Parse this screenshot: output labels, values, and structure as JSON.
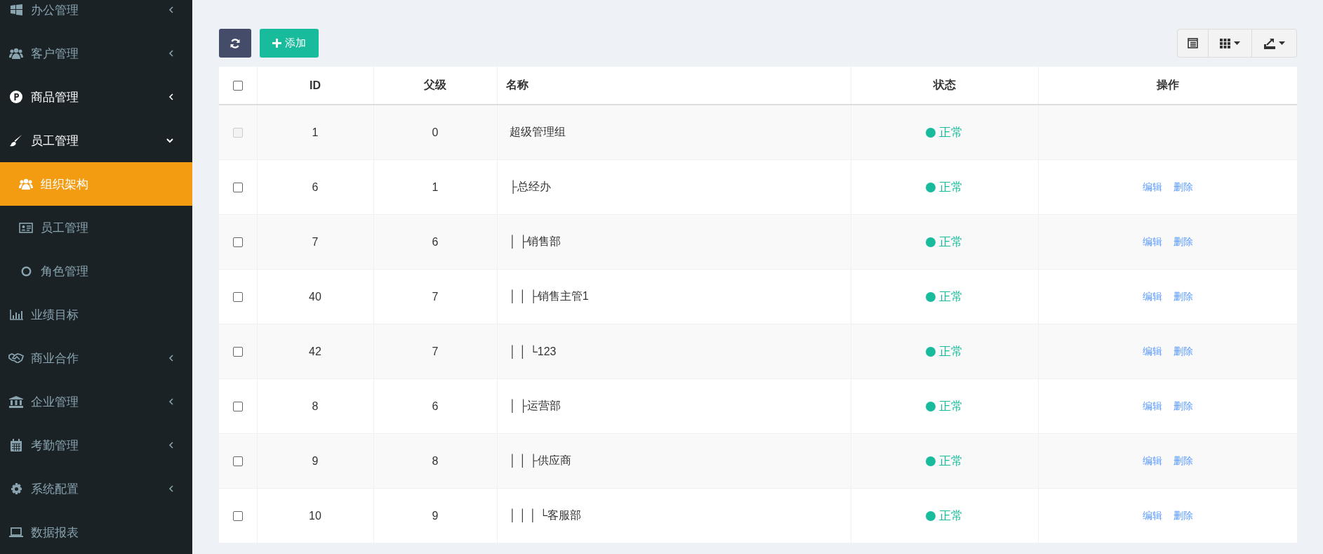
{
  "sidebar": {
    "items": [
      {
        "label": "办公管理",
        "kind": "folder",
        "expanded": false,
        "highlighted": false
      },
      {
        "label": "客户管理",
        "kind": "folder",
        "expanded": false,
        "highlighted": false
      },
      {
        "label": "商品管理",
        "kind": "folder",
        "expanded": false,
        "highlighted": true
      },
      {
        "label": "员工管理",
        "kind": "folder",
        "expanded": true,
        "highlighted": true,
        "children": [
          {
            "label": "组织架构",
            "selected": true
          },
          {
            "label": "员工管理",
            "selected": false
          },
          {
            "label": "角色管理",
            "selected": false
          }
        ]
      },
      {
        "label": "业绩目标",
        "kind": "link",
        "highlighted": false
      },
      {
        "label": "商业合作",
        "kind": "folder",
        "expanded": false,
        "highlighted": false
      },
      {
        "label": "企业管理",
        "kind": "folder",
        "expanded": false,
        "highlighted": false
      },
      {
        "label": "考勤管理",
        "kind": "folder",
        "expanded": false,
        "highlighted": false
      },
      {
        "label": "系统配置",
        "kind": "folder",
        "expanded": false,
        "highlighted": false
      },
      {
        "label": "数据报表",
        "kind": "link",
        "highlighted": false
      }
    ]
  },
  "toolbar": {
    "add_button": "添加"
  },
  "table": {
    "select_all": {
      "checked": false
    },
    "columns": [
      "ID",
      "父级",
      "名称",
      "状态",
      "操作"
    ],
    "rows": [
      {
        "checked": false,
        "disabled": true,
        "id": "1",
        "parent": "0",
        "name": "超级管理组",
        "status": "正常",
        "actions": []
      },
      {
        "checked": false,
        "disabled": false,
        "id": "6",
        "parent": "1",
        "name": "├总经办",
        "status": "正常",
        "actions": [
          "编辑",
          "删除"
        ]
      },
      {
        "checked": false,
        "disabled": false,
        "id": "7",
        "parent": "6",
        "name": "│ ├销售部",
        "status": "正常",
        "actions": [
          "编辑",
          "删除"
        ]
      },
      {
        "checked": false,
        "disabled": false,
        "id": "40",
        "parent": "7",
        "name": "│ │ ├销售主管1",
        "status": "正常",
        "actions": [
          "编辑",
          "删除"
        ]
      },
      {
        "checked": false,
        "disabled": false,
        "id": "42",
        "parent": "7",
        "name": "│ │ └123",
        "status": "正常",
        "actions": [
          "编辑",
          "删除"
        ]
      },
      {
        "checked": false,
        "disabled": false,
        "id": "8",
        "parent": "6",
        "name": "│ ├运营部",
        "status": "正常",
        "actions": [
          "编辑",
          "删除"
        ]
      },
      {
        "checked": false,
        "disabled": false,
        "id": "9",
        "parent": "8",
        "name": "│ │ ├供应商",
        "status": "正常",
        "actions": [
          "编辑",
          "删除"
        ]
      },
      {
        "checked": false,
        "disabled": false,
        "id": "10",
        "parent": "9",
        "name": "│ │ │ └客服部",
        "status": "正常",
        "actions": [
          "编辑",
          "删除"
        ]
      }
    ]
  }
}
